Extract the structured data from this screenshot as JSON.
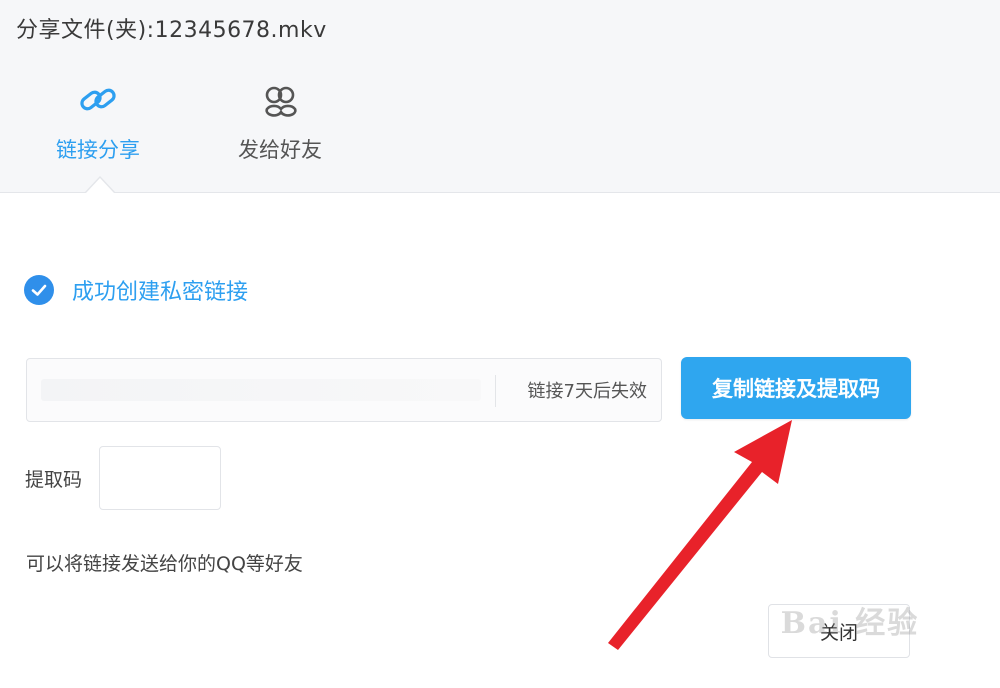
{
  "window": {
    "title": "分享文件(夹):12345678.mkv"
  },
  "tabs": [
    {
      "label": "链接分享",
      "icon": "link-icon",
      "active": true
    },
    {
      "label": "发给好友",
      "icon": "friends-icon",
      "active": false
    }
  ],
  "status": {
    "text": "成功创建私密链接",
    "icon": "check-circle-icon"
  },
  "link": {
    "value": "",
    "expire_text": "链接7天后失效"
  },
  "copy_button": {
    "label": "复制链接及提取码"
  },
  "extract_code": {
    "label": "提取码",
    "value": ""
  },
  "hint": {
    "text": "可以将链接发送给你的QQ等好友"
  },
  "close_button": {
    "label": "关闭"
  },
  "watermark": {
    "text": "Bai 经验"
  },
  "colors": {
    "accent": "#2d9ff0",
    "button_bg": "#2fa6ef",
    "annotation_arrow": "#e8222a"
  }
}
